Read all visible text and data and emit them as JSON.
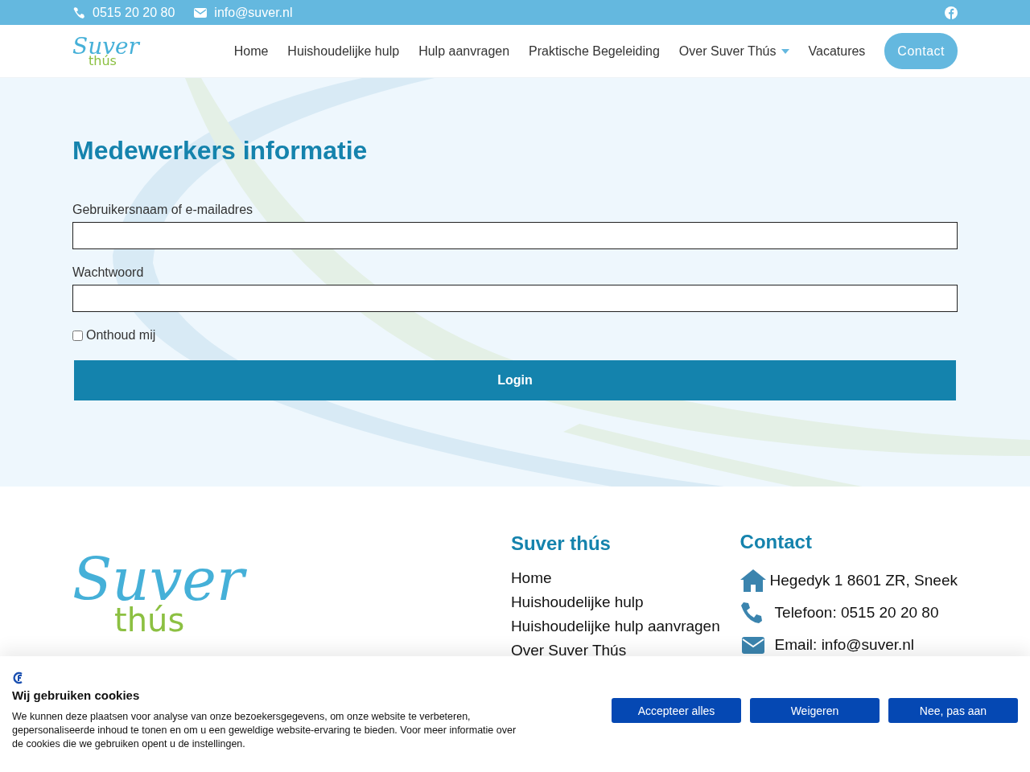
{
  "top_bar": {
    "phone": "0515 20 20 80",
    "email": "info@suver.nl"
  },
  "nav": {
    "logo": {
      "script": "Suver",
      "sub": "thús"
    },
    "items": [
      {
        "label": "Home",
        "has_dropdown": false
      },
      {
        "label": "Huishoudelijke hulp",
        "has_dropdown": false
      },
      {
        "label": "Hulp aanvragen",
        "has_dropdown": false
      },
      {
        "label": "Praktische Begeleiding",
        "has_dropdown": false
      },
      {
        "label": "Over Suver Thús",
        "has_dropdown": true
      },
      {
        "label": "Vacatures",
        "has_dropdown": false
      }
    ],
    "cta": "Contact"
  },
  "login": {
    "title": "Medewerkers informatie",
    "fields": [
      {
        "label": "Gebruikersnaam of e-mailadres"
      },
      {
        "label": "Wachtwoord"
      }
    ],
    "remember": {
      "label": "Onthoud mij",
      "checked": false
    },
    "submit": "Login"
  },
  "footer": {
    "logo": {
      "script": "Suver",
      "sub": "thús"
    },
    "links_title": "Suver thús",
    "links": [
      "Home",
      "Huishoudelijke hulp",
      "Huishoudelijke hulp aanvragen",
      "Over Suver Thús"
    ],
    "contact_title": "Contact",
    "contact": [
      {
        "kind": "address",
        "text": "Hegedyk 1 8601 ZR, Sneek"
      },
      {
        "kind": "phone",
        "text": "Telefoon: 0515 20 20 80"
      },
      {
        "kind": "email",
        "text": "Email: info@suver.nl"
      }
    ]
  },
  "cookie_banner": {
    "title": "Wij gebruiken cookies",
    "text": "We kunnen deze plaatsen voor analyse van onze bezoekersgegevens, om onze website te verbeteren, gepersonaliseerde inhoud te tonen en om u een geweldige website-ervaring te bieden. Voor meer informatie over de cookies die we gebruiken opent u de instellingen.",
    "buttons": [
      "Accepteer alles",
      "Weigeren",
      "Nee, pas aan"
    ]
  }
}
